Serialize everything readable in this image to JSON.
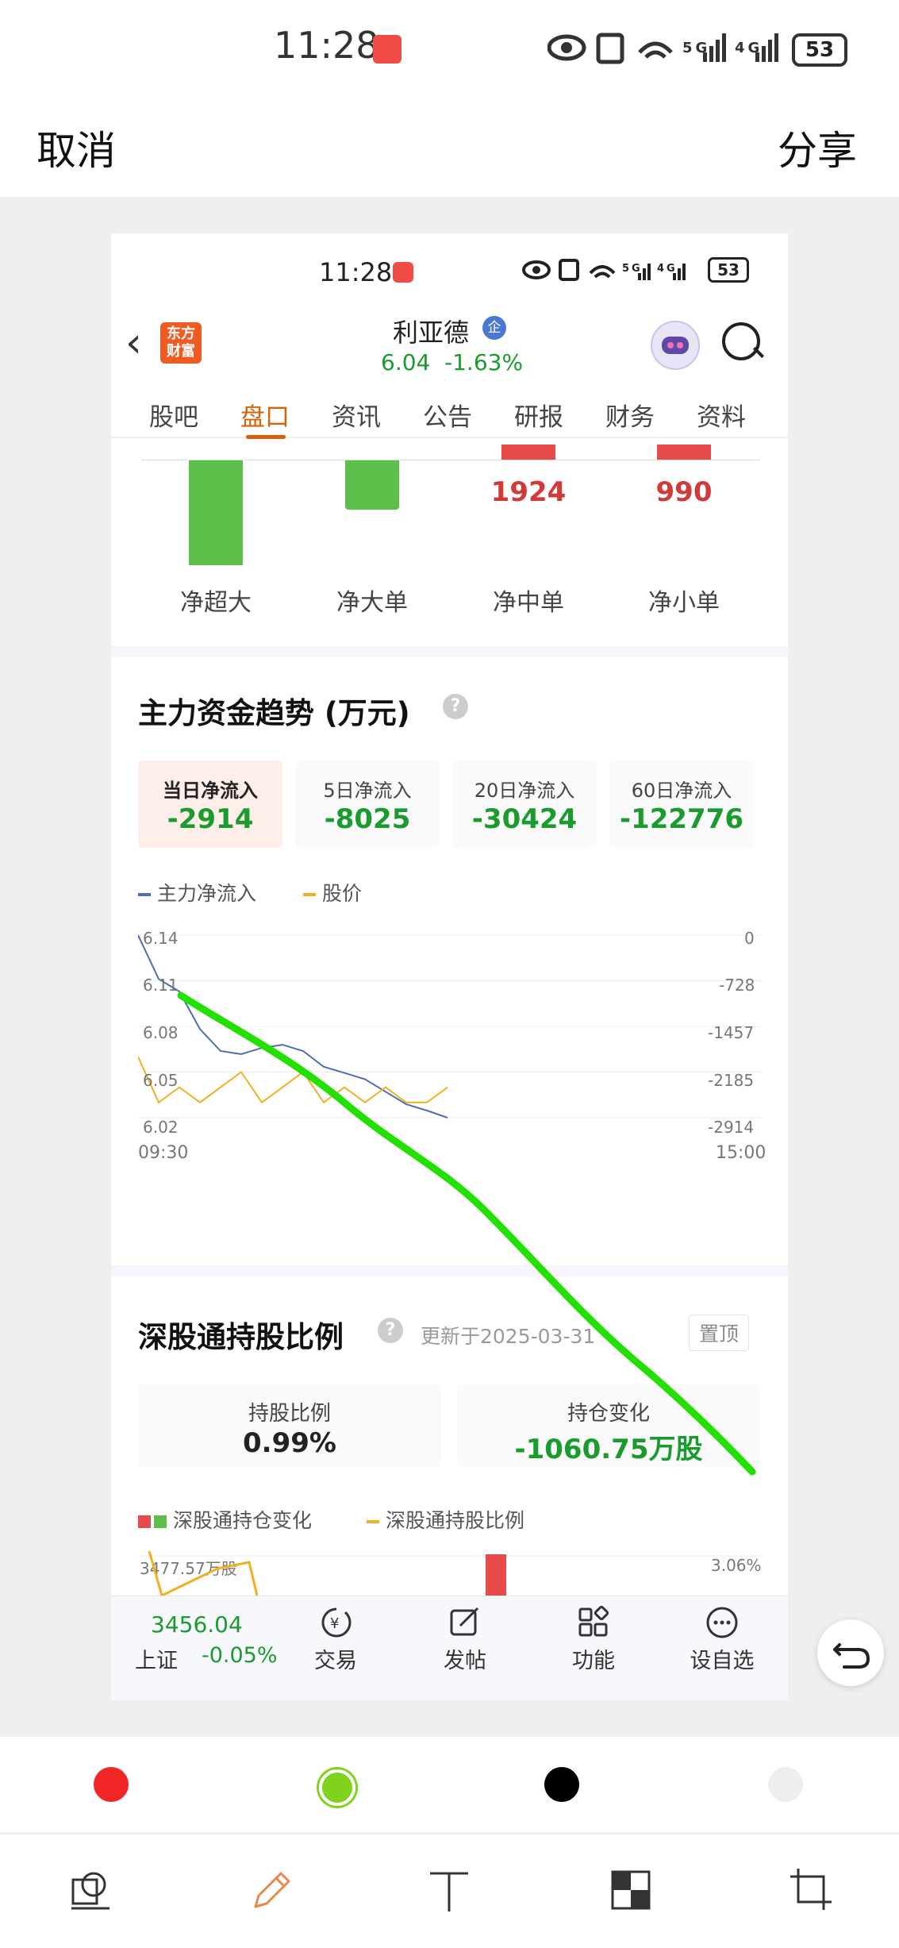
{
  "outer_status": {
    "time": "11:28",
    "battery": "53",
    "network": "N 5G 4G"
  },
  "top_bar": {
    "cancel": "取消",
    "share": "分享"
  },
  "inner_status": {
    "time": "11:28",
    "battery": "53",
    "network": "N 5G 4G"
  },
  "header": {
    "stock_name": "利亚德",
    "badge": "企",
    "price": "6.04",
    "change": "-1.63%",
    "logo_text": "东方财富"
  },
  "tabs": [
    {
      "label": "股吧"
    },
    {
      "label": "盘口"
    },
    {
      "label": "资讯"
    },
    {
      "label": "公告"
    },
    {
      "label": "研报"
    },
    {
      "label": "财务"
    },
    {
      "label": "资料"
    }
  ],
  "active_tab": "盘口",
  "flow": {
    "labels": [
      "净超大",
      "净大单",
      "净中单",
      "净小单"
    ],
    "values": [
      "",
      "",
      "1924",
      "990"
    ]
  },
  "trend": {
    "title": "主力资金趋势 (万元)",
    "cards": [
      {
        "label": "当日净流入",
        "value": "-2914"
      },
      {
        "label": "5日净流入",
        "value": "-8025"
      },
      {
        "label": "20日净流入",
        "value": "-30424"
      },
      {
        "label": "60日净流入",
        "value": "-122776"
      }
    ],
    "legend": [
      "主力净流入",
      "股价"
    ]
  },
  "chart_data": {
    "type": "line",
    "x_labels": [
      "09:30",
      "15:00"
    ],
    "y_left_ticks": [
      "6.14",
      "6.11",
      "6.08",
      "6.05",
      "6.02"
    ],
    "y_right_ticks": [
      "0",
      "-728",
      "-1457",
      "-2185",
      "-2914"
    ],
    "series": [
      {
        "name": "主力净流入",
        "color": "#4a6fb5",
        "values": [
          0,
          -700,
          -900,
          -1500,
          -1850,
          -1900,
          -1800,
          -1750,
          -1850,
          -2100,
          -2200,
          -2300,
          -2500,
          -2700,
          -2800,
          -2914
        ]
      },
      {
        "name": "股价",
        "color": "#f0b020",
        "values": [
          6.06,
          6.03,
          6.04,
          6.03,
          6.04,
          6.05,
          6.03,
          6.04,
          6.05,
          6.03,
          6.04,
          6.03,
          6.04,
          6.03,
          6.03,
          6.04
        ]
      }
    ],
    "annotation_color": "#22e000"
  },
  "szt": {
    "title": "深股通持股比例",
    "updated": "更新于2025-03-31",
    "pin": "置顶",
    "hold_ratio_label": "持股比例",
    "hold_ratio": "0.99%",
    "hold_change_label": "持仓变化",
    "hold_change": "-1060.75万股",
    "legend": [
      "深股通持仓变化",
      "深股通持股比例"
    ],
    "axis_left": "3477.57万股",
    "axis_right": "3.06%"
  },
  "bottom_nav": {
    "index_value": "3456.04",
    "index_name": "上证",
    "index_change": "-0.05%",
    "items": [
      "交易",
      "发帖",
      "功能",
      "设自选"
    ]
  },
  "palette": {
    "colors": [
      "#f12626",
      "#7fd31e",
      "#000000",
      "#eeeeee"
    ],
    "selected": 1
  }
}
